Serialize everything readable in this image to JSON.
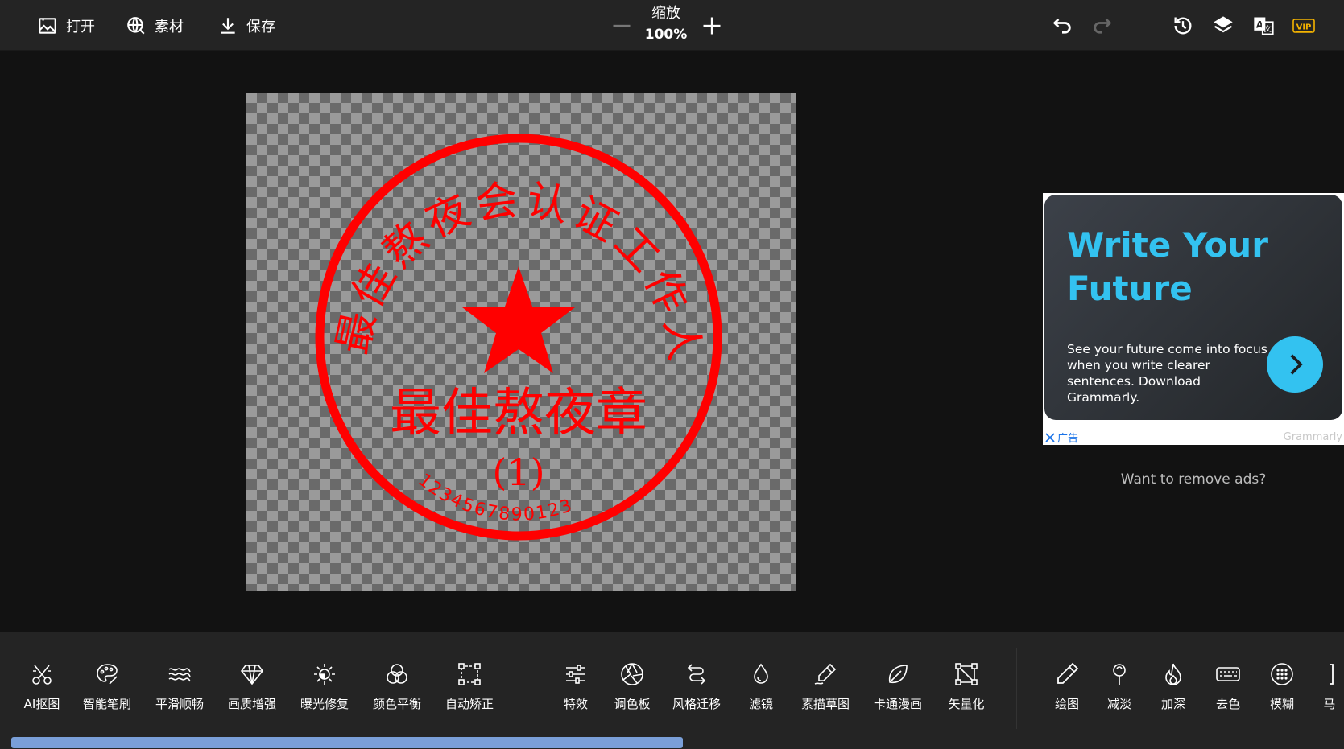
{
  "toolbar": {
    "open_label": "打开",
    "assets_label": "素材",
    "save_label": "保存",
    "zoom_label": "缩放",
    "zoom_value": "100%",
    "vip_label": "VIP"
  },
  "stamp": {
    "top_text": "最佳熬夜会认证工作人",
    "center_text": "最佳熬夜章",
    "sub_text": "(1)",
    "number_text": "1234567890123",
    "color": "#ff0000"
  },
  "ad": {
    "title": "Write Your Future",
    "body": "See your future come into focus when you write clearer sentences. Download Grammarly.",
    "ad_label": "广告",
    "brand": "Grammarly",
    "accent": "#33c2f0"
  },
  "remove_ads": "Want to remove ads?",
  "tools": [
    {
      "label": "AI抠图",
      "icon": "scissors-icon"
    },
    {
      "label": "智能笔刷",
      "icon": "palette-brush-icon"
    },
    {
      "label": "平滑顺畅",
      "icon": "waves-icon"
    },
    {
      "label": "画质增强",
      "icon": "diamond-icon"
    },
    {
      "label": "曝光修复",
      "icon": "sun-icon"
    },
    {
      "label": "颜色平衡",
      "icon": "color-circles-icon"
    },
    {
      "label": "自动矫正",
      "icon": "crop-frame-icon"
    },
    {
      "label": "特效",
      "icon": "sliders-icon"
    },
    {
      "label": "调色板",
      "icon": "aperture-icon"
    },
    {
      "label": "风格迁移",
      "icon": "transfer-icon"
    },
    {
      "label": "滤镜",
      "icon": "drop-icon"
    },
    {
      "label": "素描草图",
      "icon": "pencil-sketch-icon"
    },
    {
      "label": "卡通漫画",
      "icon": "leaf-icon"
    },
    {
      "label": "矢量化",
      "icon": "vector-icon"
    },
    {
      "label": "绘图",
      "icon": "pen-icon"
    },
    {
      "label": "减淡",
      "icon": "lollipop-icon"
    },
    {
      "label": "加深",
      "icon": "flame-icon"
    },
    {
      "label": "去色",
      "icon": "keyboard-icon"
    },
    {
      "label": "模糊",
      "icon": "blur-dots-icon"
    },
    {
      "label": "马",
      "icon": "mosaic-icon"
    }
  ]
}
